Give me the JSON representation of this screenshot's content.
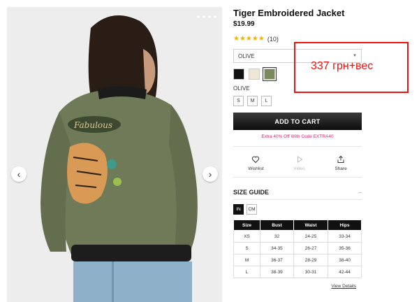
{
  "product": {
    "title": "Tiger Embroidered Jacket",
    "price": "$19.99",
    "rating_stars": "★★★★★",
    "rating_count": "(10)"
  },
  "color_select": {
    "value": "OLIVE"
  },
  "swatches": [
    {
      "name": "black",
      "color": "#111111"
    },
    {
      "name": "cream",
      "color": "#efe7d6"
    },
    {
      "name": "olive",
      "color": "#7b8a5a"
    }
  ],
  "selected_color_label": "OLIVE",
  "sizes": [
    "S",
    "M",
    "L"
  ],
  "add_to_cart_label": "ADD TO CART",
  "promo_text": "Extra 40% Off With Code EXTRA40",
  "actions": {
    "wishlist": "Wishlist",
    "video": "Video",
    "share": "Share"
  },
  "size_guide": {
    "title": "SIZE GUIDE",
    "toggle": "–",
    "units": [
      "IN",
      "CM"
    ],
    "headers": [
      "Size",
      "Bust",
      "Waist",
      "Hips"
    ],
    "rows": [
      [
        "XS",
        "32",
        "24-25",
        "33-34"
      ],
      [
        "S",
        "34-35",
        "26-27",
        "35-36"
      ],
      [
        "M",
        "36-37",
        "28-29",
        "38-40"
      ],
      [
        "L",
        "38-39",
        "30-31",
        "42-44"
      ]
    ],
    "view_details": "View Details"
  },
  "annotation": {
    "text": "337 грн+вес",
    "color": "#e11111"
  },
  "icons": {
    "prev": "chevron-left-icon",
    "next": "chevron-right-icon",
    "wishlist": "heart-icon",
    "video": "play-icon",
    "share": "share-icon",
    "select": "caret-down-icon"
  }
}
